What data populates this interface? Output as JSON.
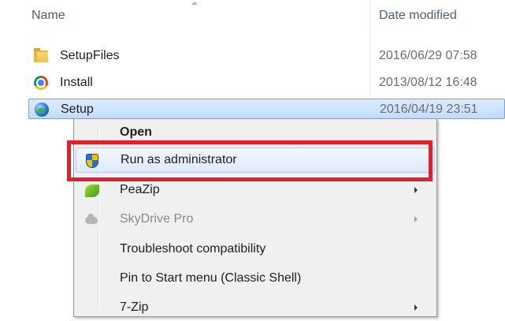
{
  "columns": {
    "name": "Name",
    "date_modified": "Date modified"
  },
  "files": [
    {
      "name": "SetupFiles",
      "date": "2016/06/29 07:58",
      "icon": "folder-icon"
    },
    {
      "name": "Install",
      "date": "2013/08/12 16:48",
      "icon": "chrome-icon"
    },
    {
      "name": "Setup",
      "date": "2016/04/19 23:51",
      "icon": "setup-globe-icon"
    }
  ],
  "context_menu": {
    "items": [
      {
        "label": "Open",
        "bold": true
      },
      {
        "label": "Run as administrator",
        "icon": "uac-shield-icon",
        "highlighted": true
      },
      {
        "label": "PeaZip",
        "icon": "peazip-icon",
        "submenu": true
      },
      {
        "label": "SkyDrive Pro",
        "icon": "skydrive-cloud-icon",
        "submenu": true,
        "disabled": true
      },
      {
        "label": "Troubleshoot compatibility"
      },
      {
        "label": "Pin to Start menu (Classic Shell)"
      },
      {
        "label": "7-Zip",
        "submenu": true
      }
    ]
  },
  "colors": {
    "callout_border": "#e0202a",
    "selection_border": "#7da2ce"
  }
}
